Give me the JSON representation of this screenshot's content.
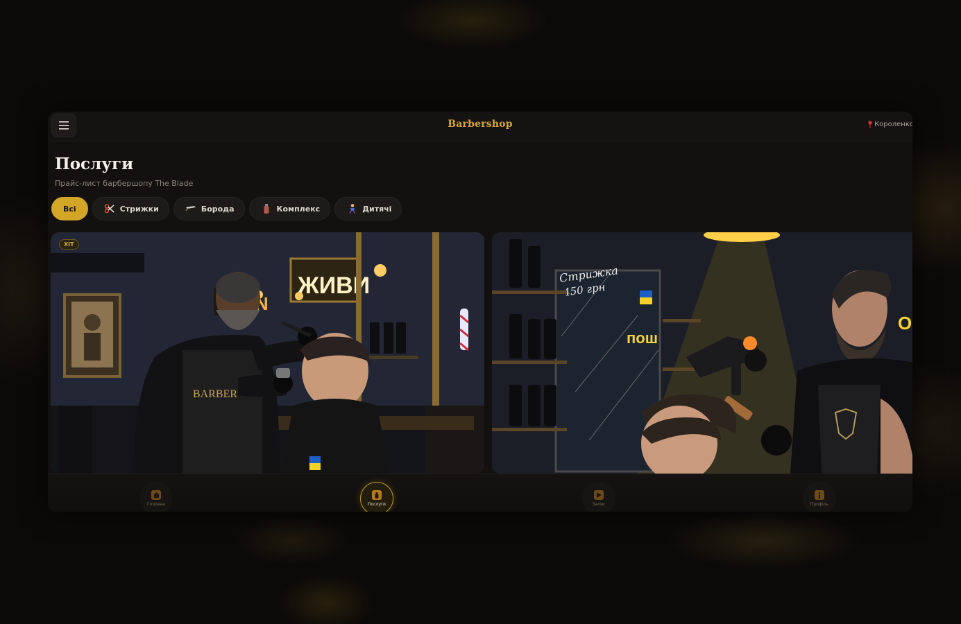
{
  "header": {
    "brand": "Barbershop",
    "location": "Короленко"
  },
  "page": {
    "title": "Послуги",
    "subtitle": "Прайс-лист барбершопу The Blade"
  },
  "filters": [
    {
      "label": "Всі",
      "active": true
    },
    {
      "label": "Стрижки",
      "icon": "scissors-icon"
    },
    {
      "label": "Борода",
      "icon": "razor-icon"
    },
    {
      "label": "Комплекс",
      "icon": "bottle-icon"
    },
    {
      "label": "Дитячі",
      "icon": "child-icon"
    }
  ],
  "cards": [
    {
      "badge": "ХІТ",
      "image_texts": [
        "OPEN",
        "ЖИВИ",
        "BARBER"
      ]
    },
    {
      "image_texts": [
        "Стрижка",
        "450 грн",
        "пош",
        "OP"
      ]
    }
  ],
  "bottom_nav": [
    {
      "label": "Головна",
      "icon": "home-icon"
    },
    {
      "label": "Послуги",
      "icon": "services-icon",
      "active": true
    },
    {
      "label": "Запис",
      "icon": "play-icon"
    },
    {
      "label": "Профіль",
      "icon": "info-icon"
    }
  ],
  "colors": {
    "accent": "#d3a628",
    "background": "#121110",
    "text": "#f5f1ea"
  }
}
